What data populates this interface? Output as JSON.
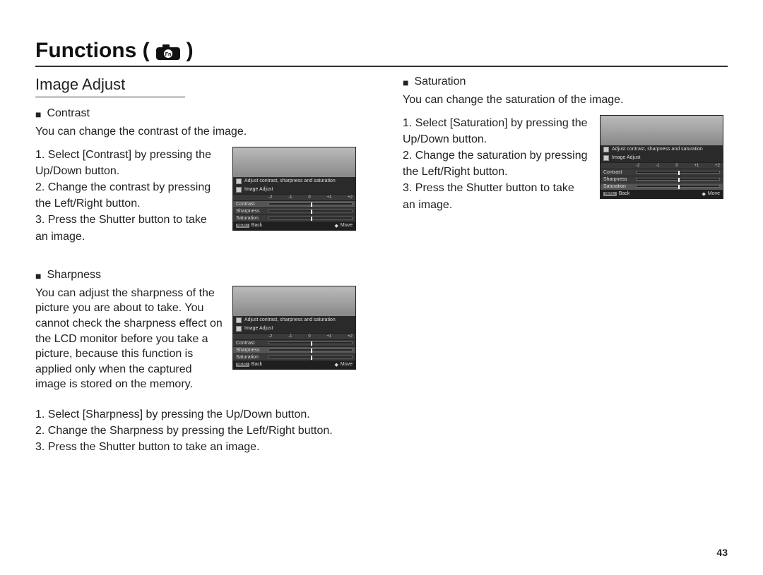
{
  "pageTitle": "Functions (",
  "pageTitleClose": ")",
  "subsection": "Image Adjust",
  "pageNumber": "43",
  "screen": {
    "banner": "Adjust contrast, sharpness and saturation",
    "menuLabel": "Image Adjust",
    "ticks": [
      "-2",
      "-1",
      "0",
      "+1",
      "+2"
    ],
    "rows": [
      "Contrast",
      "Sharpness",
      "Saturation"
    ],
    "footBack": "Back",
    "footMove": "Move",
    "menuBadge": "MENU"
  },
  "contrast": {
    "title": "Contrast",
    "desc": "You can change the contrast of the image.",
    "steps": [
      "1. Select [Contrast] by pressing the Up/Down button.",
      "2. Change the contrast by pressing the Left/Right button.",
      "3. Press the Shutter button to take an image."
    ]
  },
  "sharpness": {
    "title": "Sharpness",
    "desc": "You can adjust the sharpness of the picture you are about to take. You cannot check the sharpness effect on the LCD monitor before you take a picture, because this function is applied only when the captured image is stored on the memory.",
    "steps": [
      "1. Select [Sharpness] by pressing the Up/Down button.",
      "2. Change the Sharpness by pressing the Left/Right button.",
      "3. Press the Shutter button to take an image."
    ]
  },
  "saturation": {
    "title": "Saturation",
    "desc": "You can change the saturation of the image.",
    "steps": [
      "1. Select [Saturation] by pressing the Up/Down button.",
      "2. Change the saturation by pressing the Left/Right button.",
      "3. Press the Shutter button to take an image."
    ]
  }
}
